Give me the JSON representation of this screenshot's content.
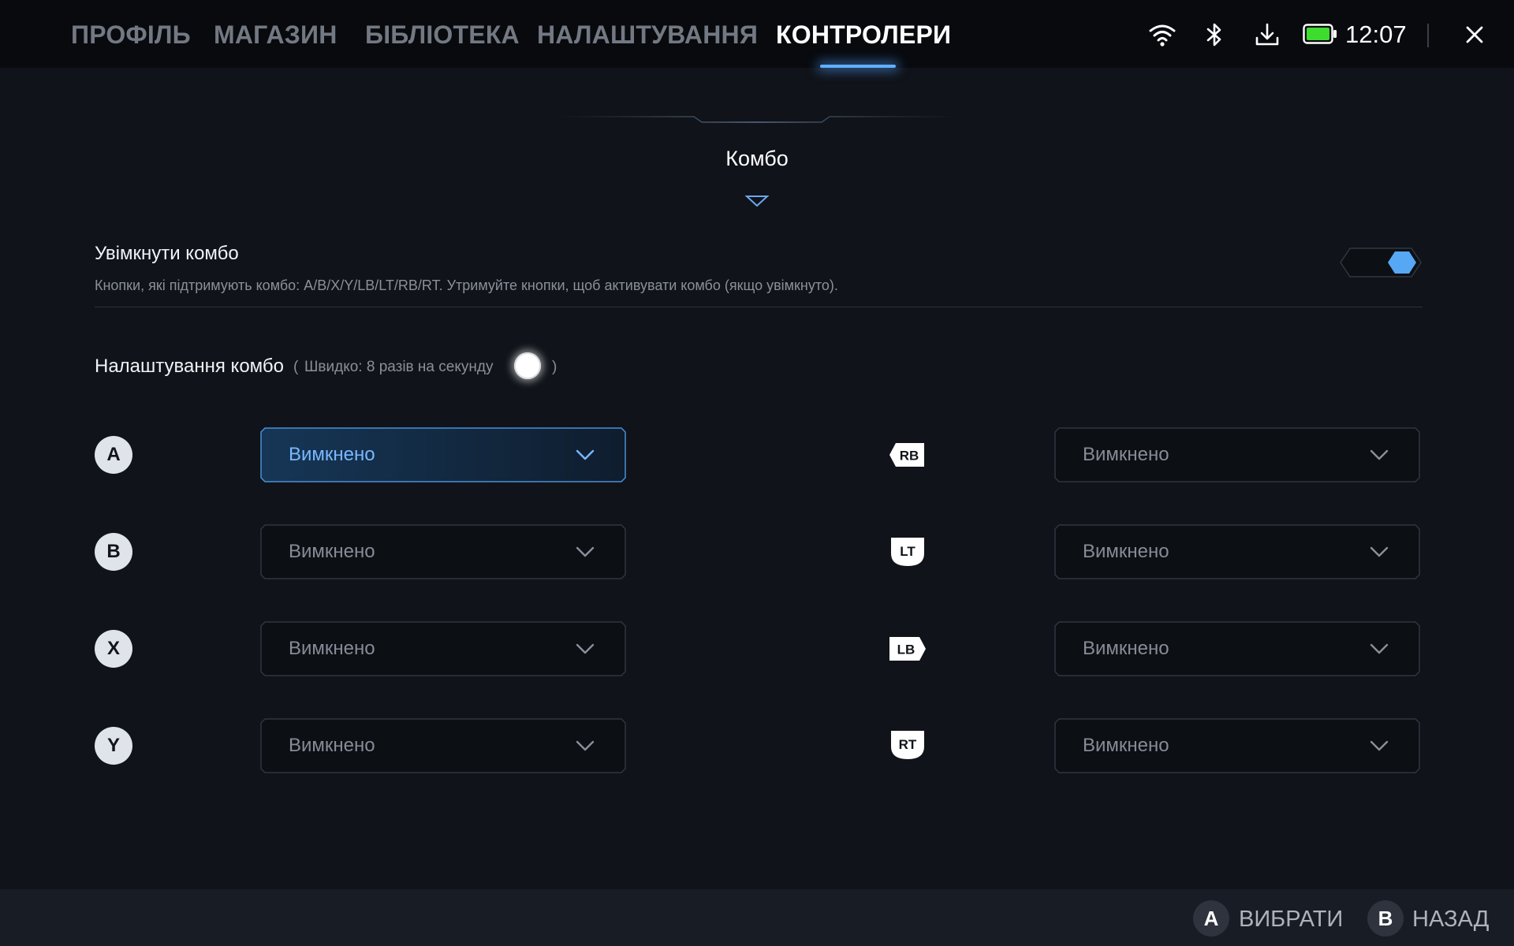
{
  "topbar": {
    "tabs": [
      {
        "label": "ПРОФІЛЬ",
        "active": false
      },
      {
        "label": "МАГАЗИН",
        "active": false
      },
      {
        "label": "БІБЛІОТЕКА",
        "active": false
      },
      {
        "label": "НАЛАШТУВАННЯ",
        "active": false
      },
      {
        "label": "КОНТРОЛЕРИ",
        "active": true
      }
    ],
    "status_icons": [
      "wifi-icon",
      "bluetooth-icon",
      "download-icon",
      "battery-icon"
    ],
    "battery_level": 1.0,
    "time": "12:07",
    "close_icon": "close-icon"
  },
  "section": {
    "title": "Комбо"
  },
  "enable": {
    "title": "Увімкнути комбо",
    "description": "Кнопки, які підтримують комбо: A/B/X/Y/LB/LT/RB/RT. Утримуйте кнопки, щоб активувати комбо (якщо увімкнуто).",
    "toggle_on": true
  },
  "combo_settings": {
    "title": "Налаштування комбо",
    "paren_open": "(",
    "speed_text": "Швидко: 8 разів на секунду",
    "paren_close": ")"
  },
  "left_rows": [
    {
      "button": "A",
      "value": "Вимкнено",
      "focused": true
    },
    {
      "button": "B",
      "value": "Вимкнено",
      "focused": false
    },
    {
      "button": "X",
      "value": "Вимкнено",
      "focused": false
    },
    {
      "button": "Y",
      "value": "Вимкнено",
      "focused": false
    }
  ],
  "right_rows": [
    {
      "button": "RB",
      "value": "Вимкнено",
      "focused": false
    },
    {
      "button": "LT",
      "value": "Вимкнено",
      "focused": false
    },
    {
      "button": "LB",
      "value": "Вимкнено",
      "focused": false
    },
    {
      "button": "RT",
      "value": "Вимкнено",
      "focused": false
    }
  ],
  "bottombar": {
    "hints": [
      {
        "button": "A",
        "label": "ВИБРАТИ"
      },
      {
        "button": "B",
        "label": "НАЗАД"
      }
    ]
  },
  "colors": {
    "accent": "#5fb0ff",
    "background": "#101319",
    "battery": "#3ddc2f"
  }
}
